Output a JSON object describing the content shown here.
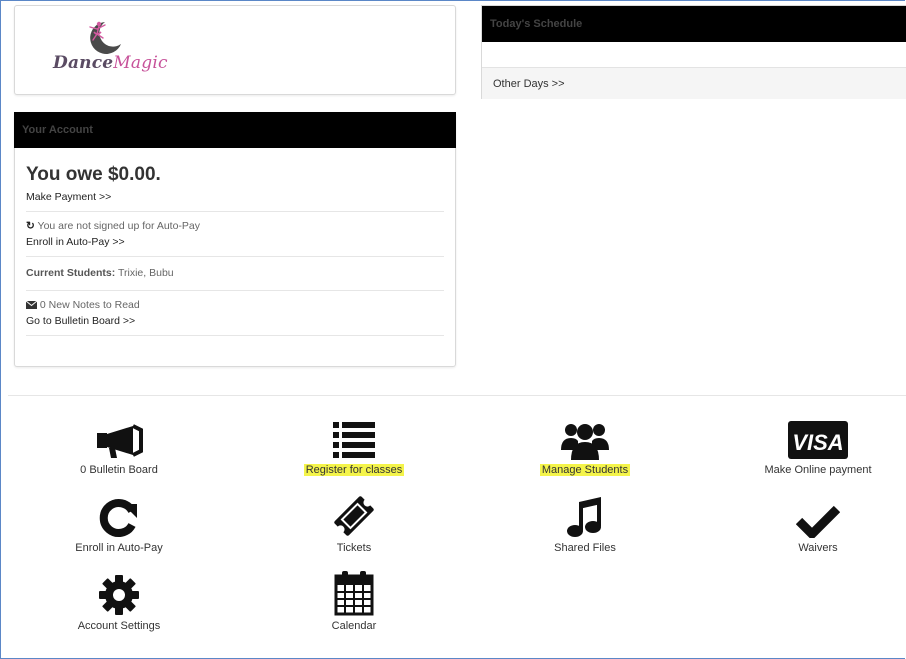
{
  "logo": {
    "word1": "Dance",
    "word2": "Magic"
  },
  "schedule": {
    "title": "Today's Schedule",
    "other_days": "Other Days >>"
  },
  "account": {
    "title": "Your Account",
    "owe": "You owe $0.00.",
    "make_payment": "Make Payment >>",
    "autopay_status": "You are not signed up for Auto-Pay",
    "enroll_autopay": "Enroll in Auto-Pay >>",
    "students_label": "Current Students:",
    "students_value": "Trixie, Bubu",
    "notes": "0 New Notes to Read",
    "bulletin_link": "Go to Bulletin Board >>"
  },
  "tiles": {
    "bulletin": "0 Bulletin Board",
    "register": "Register for classes",
    "students": "Manage Students",
    "payment": "Make Online payment",
    "visa": "VISA",
    "autopay": "Enroll in Auto-Pay",
    "tickets": "Tickets",
    "files": "Shared Files",
    "waivers": "Waivers",
    "settings": "Account Settings",
    "calendar": "Calendar"
  },
  "colors": {
    "highlight": "#f4f44a",
    "header": "#000000",
    "frame": "#5b87c7"
  }
}
